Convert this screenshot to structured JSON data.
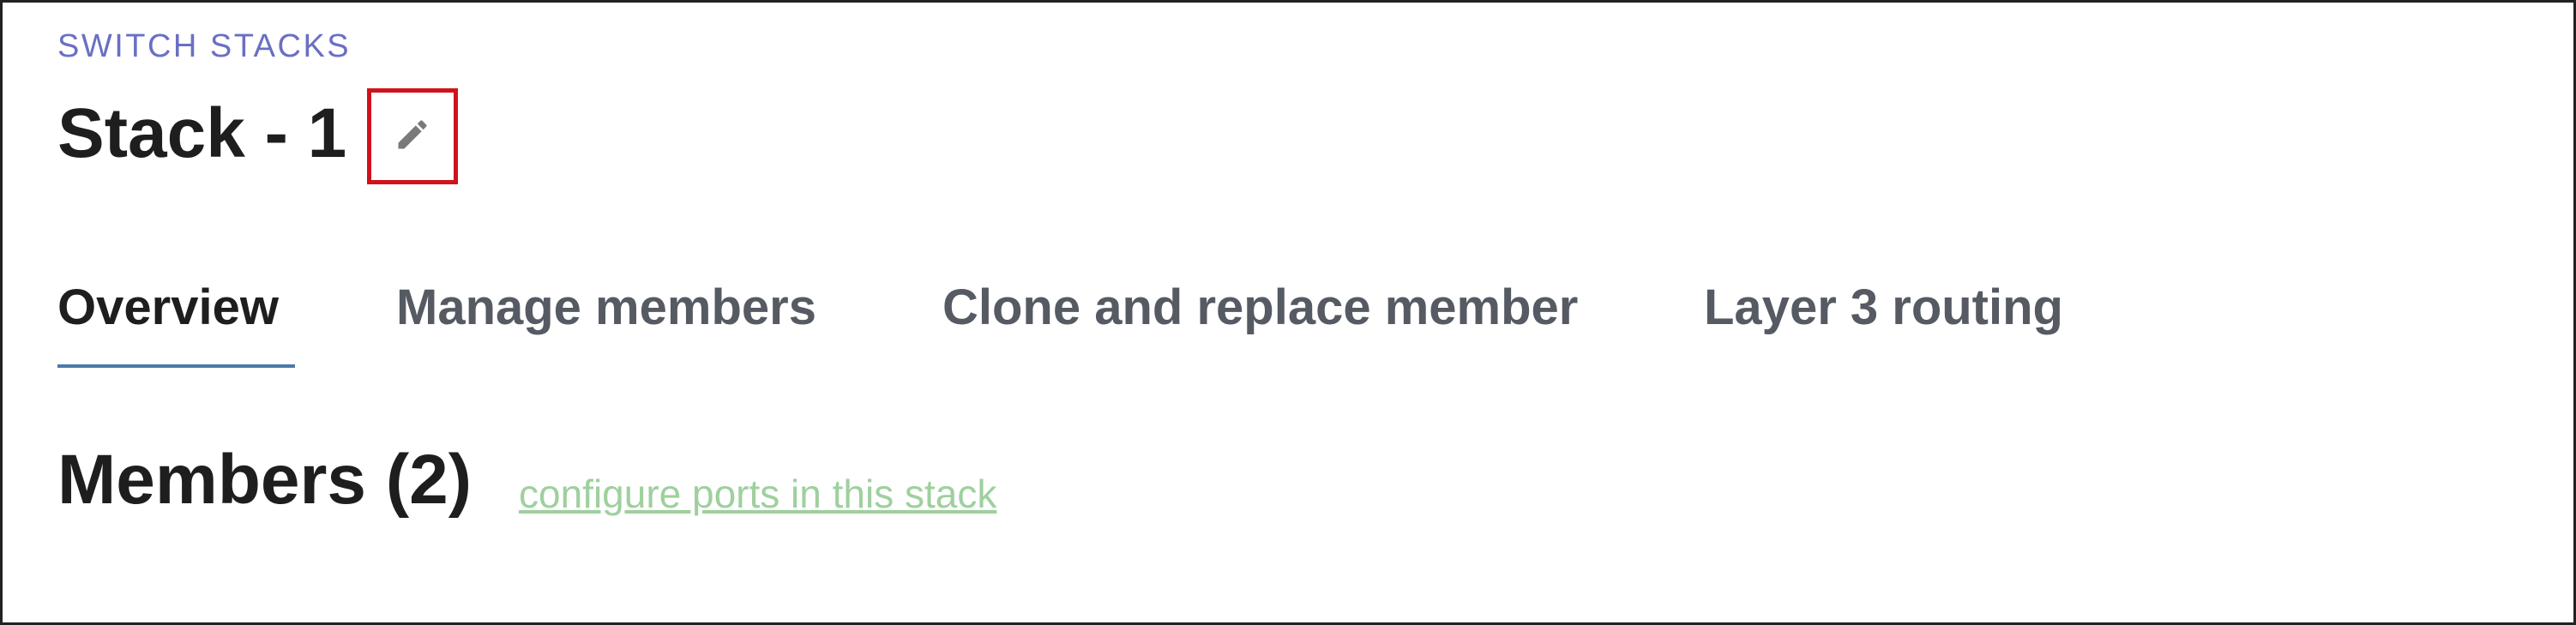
{
  "header": {
    "breadcrumb": "SWITCH STACKS",
    "title": "Stack - 1",
    "edit_icon": "pencil-icon"
  },
  "tabs": [
    {
      "label": "Overview",
      "active": true
    },
    {
      "label": "Manage members",
      "active": false
    },
    {
      "label": "Clone and replace member",
      "active": false
    },
    {
      "label": "Layer 3 routing",
      "active": false
    }
  ],
  "members": {
    "title": "Members (2)",
    "configure_link": "configure ports in this stack"
  },
  "colors": {
    "breadcrumb": "#6a6fc4",
    "highlight_box": "#d0121b",
    "tab_underline": "#4a7aa9",
    "link": "#9ed09e"
  }
}
